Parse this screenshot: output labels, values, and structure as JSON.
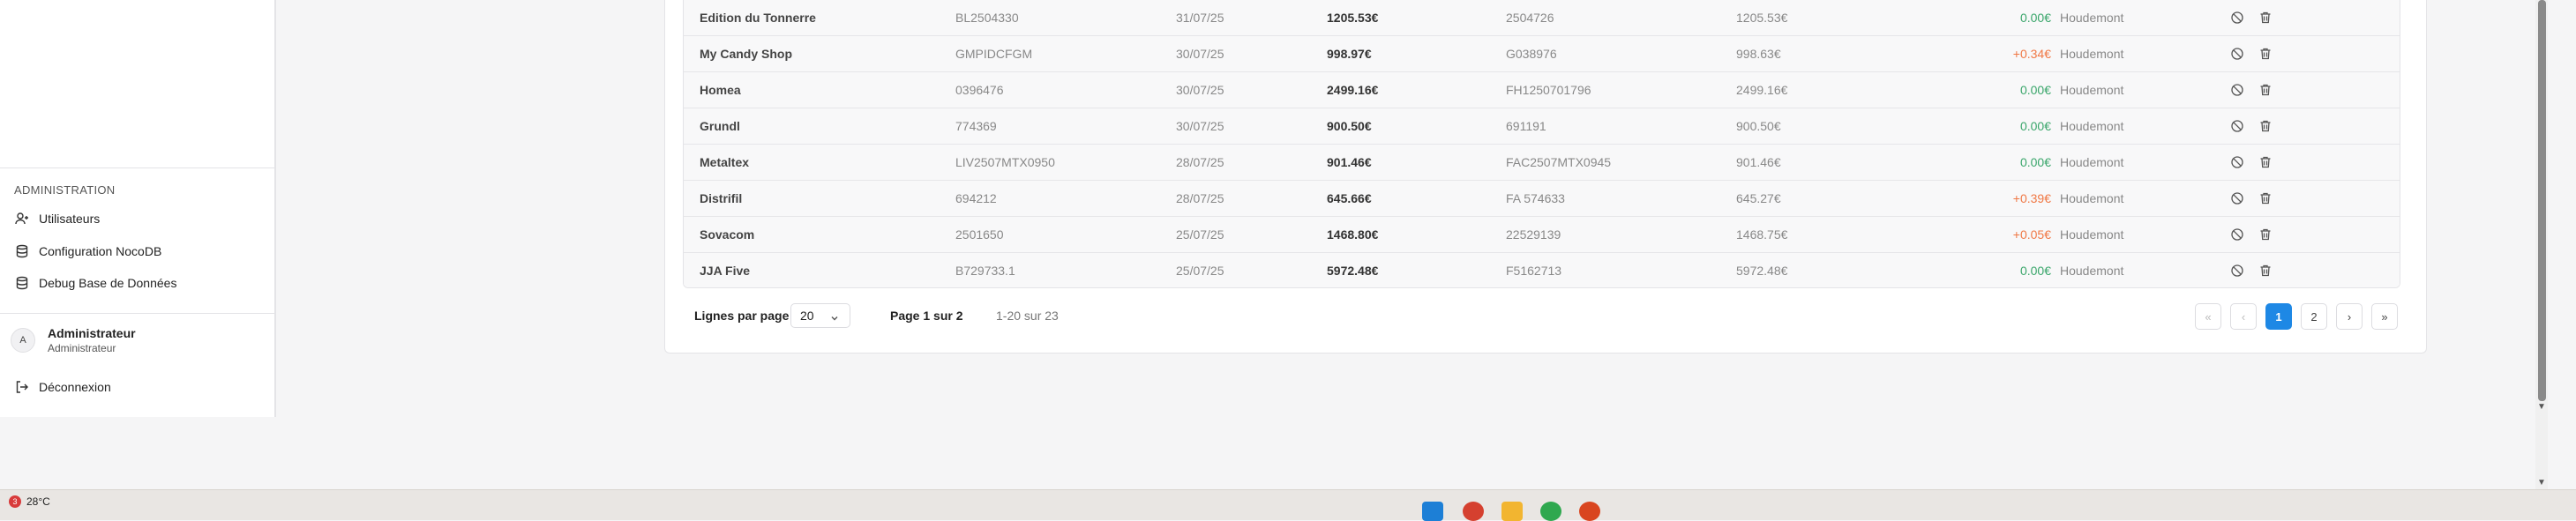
{
  "sidebar": {
    "section_title": "ADMINISTRATION",
    "items": [
      {
        "label": "Utilisateurs",
        "icon": "users-icon"
      },
      {
        "label": "Configuration NocoDB",
        "icon": "database-icon"
      },
      {
        "label": "Debug Base de Données",
        "icon": "database-debug-icon"
      }
    ],
    "user": {
      "initial": "A",
      "name": "Administrateur",
      "role": "Administrateur"
    },
    "logout_label": "Déconnexion"
  },
  "table": {
    "rows": [
      {
        "supplier": "Edition du Tonnerre",
        "bl": "BL2504330",
        "date": "31/07/25",
        "amount": "1205.53€",
        "invoice": "2504726",
        "invoice_amount": "1205.53€",
        "diff": "0.00€",
        "diff_status": "zero",
        "site": "Houdemont"
      },
      {
        "supplier": "My Candy Shop",
        "bl": "GMPIDCFGM",
        "date": "30/07/25",
        "amount": "998.97€",
        "invoice": "G038976",
        "invoice_amount": "998.63€",
        "diff": "+0.34€",
        "diff_status": "pos",
        "site": "Houdemont"
      },
      {
        "supplier": "Homea",
        "bl": "0396476",
        "date": "30/07/25",
        "amount": "2499.16€",
        "invoice": "FH1250701796",
        "invoice_amount": "2499.16€",
        "diff": "0.00€",
        "diff_status": "zero",
        "site": "Houdemont"
      },
      {
        "supplier": "Grundl",
        "bl": "774369",
        "date": "30/07/25",
        "amount": "900.50€",
        "invoice": "691191",
        "invoice_amount": "900.50€",
        "diff": "0.00€",
        "diff_status": "zero",
        "site": "Houdemont"
      },
      {
        "supplier": "Metaltex",
        "bl": "LIV2507MTX0950",
        "date": "28/07/25",
        "amount": "901.46€",
        "invoice": "FAC2507MTX0945",
        "invoice_amount": "901.46€",
        "diff": "0.00€",
        "diff_status": "zero",
        "site": "Houdemont"
      },
      {
        "supplier": "Distrifil",
        "bl": "694212",
        "date": "28/07/25",
        "amount": "645.66€",
        "invoice": "FA 574633",
        "invoice_amount": "645.27€",
        "diff": "+0.39€",
        "diff_status": "pos",
        "site": "Houdemont"
      },
      {
        "supplier": "Sovacom",
        "bl": "2501650",
        "date": "25/07/25",
        "amount": "1468.80€",
        "invoice": "22529139",
        "invoice_amount": "1468.75€",
        "diff": "+0.05€",
        "diff_status": "pos",
        "site": "Houdemont"
      },
      {
        "supplier": "JJA Five",
        "bl": "B729733.1",
        "date": "25/07/25",
        "amount": "5972.48€",
        "invoice": "F5162713",
        "invoice_amount": "5972.48€",
        "diff": "0.00€",
        "diff_status": "zero",
        "site": "Houdemont"
      }
    ]
  },
  "pagination": {
    "rows_per_page_label": "Lignes par page",
    "rows_per_page_value": "20",
    "page_info": "Page 1 sur 2",
    "range_info": "1-20 sur 23",
    "pages": [
      "1",
      "2"
    ],
    "current_page": "1"
  },
  "taskbar": {
    "weather_badge": "3",
    "temperature": "28°C"
  },
  "colors": {
    "accent": "#1e88e5",
    "diff_zero": "#3aa66b",
    "diff_positive": "#f07845"
  }
}
